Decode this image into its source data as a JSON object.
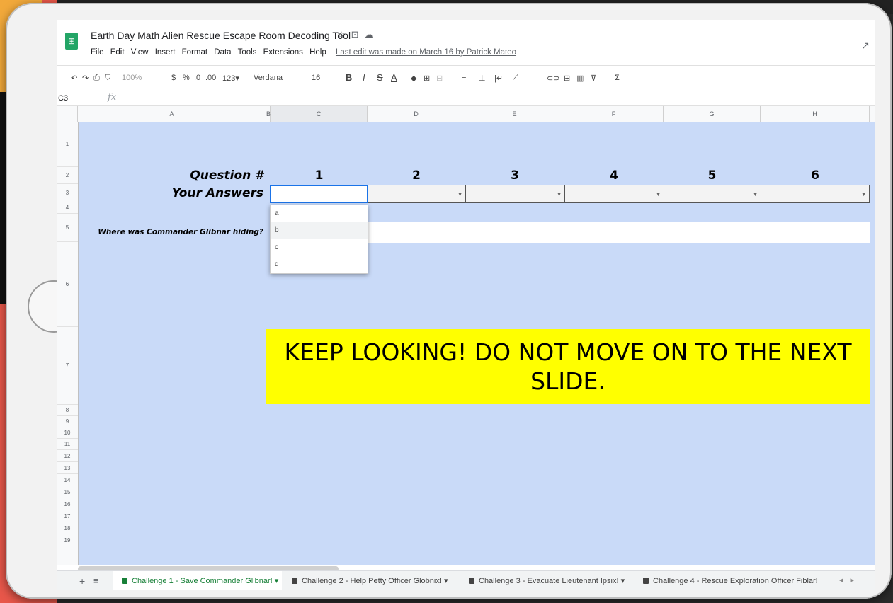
{
  "doc": {
    "title": "Earth Day Math Alien Rescue Escape Room Decoding Tool",
    "title_icons": [
      "star-icon",
      "move-to-folder-icon",
      "cloud-status-icon"
    ],
    "menu": [
      "File",
      "Edit",
      "View",
      "Insert",
      "Format",
      "Data",
      "Tools",
      "Extensions",
      "Help"
    ],
    "last_edit": "Last edit was made on March 16 by Patrick Mateo"
  },
  "toolbar": {
    "undo": "↶",
    "redo": "↷",
    "print": "⎙",
    "paint_format": "⛉",
    "zoom": "100%",
    "currency": "$",
    "percent": "%",
    "dec_less": ".0",
    "dec_more": ".00",
    "more_formats": "123▾",
    "font": "Verdana",
    "font_size": "16",
    "bold": "B",
    "italic": "I",
    "strike": "S",
    "text_color": "A",
    "fill": "◆",
    "borders": "⊞",
    "merge": "⊟",
    "halign": "≡",
    "valign": "⊥",
    "wrap": "|↵",
    "rotate": "⟋",
    "link": "⊂⊃",
    "comment": "⊞",
    "chart": "▥",
    "filter": "⊽",
    "functions": "Σ"
  },
  "formula_bar": {
    "cell_ref": "C3",
    "fx": "fx",
    "value": ""
  },
  "grid": {
    "columns": [
      "A",
      "B",
      "C",
      "D",
      "E",
      "F",
      "G",
      "H"
    ],
    "rows": [
      "1",
      "2",
      "3",
      "4",
      "5",
      "6",
      "7",
      "8",
      "9",
      "10",
      "11",
      "12",
      "13",
      "14",
      "15",
      "16",
      "17",
      "18",
      "19"
    ],
    "question_label": "Question #",
    "answers_label": "Your Answers",
    "question_numbers": [
      "1",
      "2",
      "3",
      "4",
      "5",
      "6"
    ],
    "hiding_label": "Where was Commander Glibnar hiding?",
    "dropdown_options": [
      "a",
      "b",
      "c",
      "d"
    ],
    "banner": "KEEP LOOKING! DO NOT MOVE ON TO THE NEXT SLIDE."
  },
  "tabs": [
    "Challenge 1 - Save Commander Glibnar!",
    "Challenge 2 - Help Petty Officer Globnix!",
    "Challenge 3 - Evacuate Lieutenant Ipsix!",
    "Challenge 4 - Rescue Exploration Officer Fiblar!"
  ],
  "colors": {
    "grid_fill": "#c9daf8",
    "banner_fill": "#ffff00",
    "sheets_green": "#23a566",
    "active_tab_text": "#188038"
  }
}
